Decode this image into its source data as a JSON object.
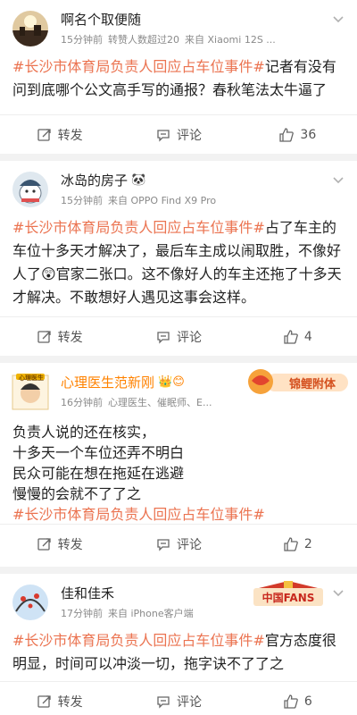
{
  "posts": [
    {
      "name": "啊名个取便随",
      "meta": [
        "15分钟前",
        "转赞人数超过20",
        "来自 Xiaomi 12S ..."
      ],
      "text": [
        {
          "tag": "#长沙市体育局负责人回应占车位事件#"
        },
        {
          "plain": "记者有没有问到底哪个公文高手写的通报？春秋笔法太牛逼了"
        }
      ],
      "repost": "转发",
      "comment": "评论",
      "likes": "36"
    },
    {
      "name": "冰岛的房子",
      "name_emoji": "🐼",
      "meta": [
        "15分钟前",
        "来自 OPPO Find X9 Pro"
      ],
      "text": [
        {
          "tag": "#长沙市体育局负责人回应占车位事件#"
        },
        {
          "plain": "占了车主的车位十多天才解决了，最后车主成以闹取胜，不像好人了😲官家二张口。这不像好人的车主还拖了十多天才解决。不敢想好人遇见这事会这样。"
        }
      ],
      "repost": "转发",
      "comment": "评论",
      "likes": "4"
    },
    {
      "name": "心理医生范新刚",
      "name_badges": "👑😊",
      "meta": [
        "16分钟前",
        "心理医生、催眠师、E..."
      ],
      "decoration": "锦鲤附体",
      "avatar_label": "心理医生",
      "lines": [
        "负责人说的还在核实，",
        "十多天一个车位还弄不明白",
        "民众可能在想在拖延在逃避",
        "慢慢的会就不了了之"
      ],
      "tag_line": "#长沙市体育局负责人回应占车位事件#",
      "repost": "转发",
      "comment": "评论",
      "likes": "2"
    },
    {
      "name": "佳和佳禾",
      "meta": [
        "17分钟前",
        "来自 iPhone客户端"
      ],
      "decoration": "中国FANS",
      "text": [
        {
          "tag": "#长沙市体育局负责人回应占车位事件#"
        },
        {
          "plain": "官方态度很明显，时间可以冲淡一切，拖字诀不了了之"
        }
      ],
      "repost": "转发",
      "comment": "评论",
      "likes": "6"
    }
  ],
  "colors": {
    "accent": "#eb7350",
    "vip": "#ff8200"
  },
  "icons": [
    "chevron-down-icon",
    "repost-icon",
    "comment-icon",
    "like-icon"
  ]
}
